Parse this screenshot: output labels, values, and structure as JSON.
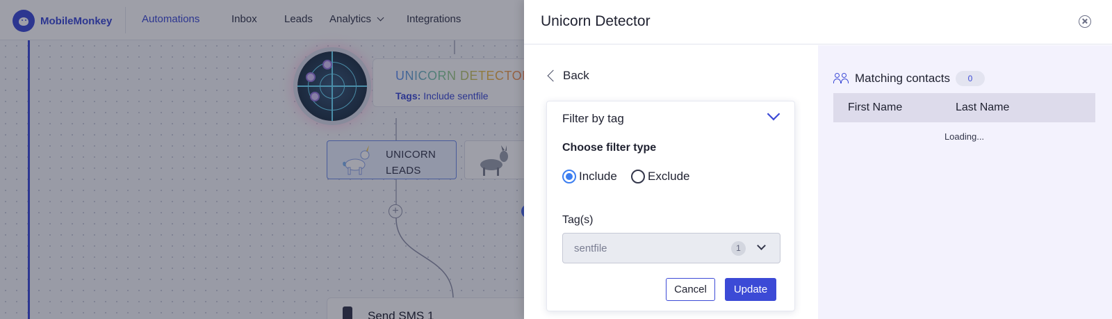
{
  "nav": {
    "brand": "MobileMonkey",
    "items": [
      {
        "label": "Automations",
        "active": true
      },
      {
        "label": "Inbox"
      },
      {
        "label": "Leads"
      },
      {
        "label": "Analytics"
      },
      {
        "label": "Integrations"
      }
    ]
  },
  "flow": {
    "node_title": "UNICORN DETECTOR",
    "tags_prefix": "Tags:",
    "tags_value": "Include sentfile",
    "branch_a_label": "UNICORN LEADS",
    "sms_label": "Send SMS 1",
    "plus": "+"
  },
  "panel": {
    "title": "Unicorn Detector",
    "back_label": "Back",
    "filter": {
      "heading": "Filter by tag",
      "choose_label": "Choose filter type",
      "options": {
        "include": "Include",
        "exclude": "Exclude"
      },
      "selected": "include",
      "tags_label": "Tag(s)",
      "tag_value": "sentfile",
      "tag_count": "1",
      "cancel_label": "Cancel",
      "update_label": "Update"
    },
    "contacts": {
      "label": "Matching contacts",
      "count": "0",
      "columns": [
        "First Name",
        "Last Name"
      ],
      "status": "Loading..."
    }
  },
  "colors": {
    "accent": "#3c4ad6",
    "radio": "#3c7ef0",
    "right_pane_bg": "#f3f2fd"
  }
}
